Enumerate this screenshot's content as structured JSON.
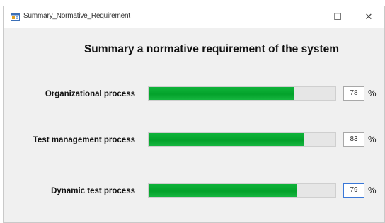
{
  "window": {
    "title": "Summary_Normative_Requirement",
    "controls": {
      "minimize": "–",
      "maximize": "☐",
      "close": "✕"
    }
  },
  "heading": "Summary a normative requirement of the system",
  "rows": [
    {
      "label": "Organizational process",
      "value": "78",
      "percent": 78,
      "unit": "%"
    },
    {
      "label": "Test management process",
      "value": "83",
      "percent": 83,
      "unit": "%"
    },
    {
      "label": "Dynamic test process",
      "value": "79",
      "percent": 79,
      "unit": "%"
    }
  ],
  "colors": {
    "bar_fill": "#06a62e",
    "bar_track": "#e6e6e6",
    "window_bg": "#f0f0f0"
  },
  "icons": {
    "app": "app-form-icon"
  }
}
